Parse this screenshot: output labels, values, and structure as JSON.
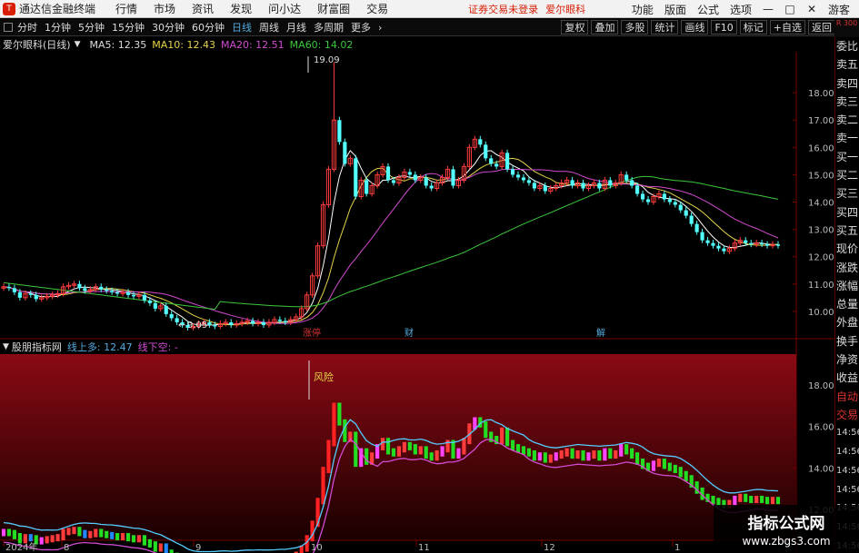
{
  "menubar": {
    "app_title": "通达信金融终端",
    "menus": [
      "行情",
      "市场",
      "资讯",
      "发现",
      "问小达",
      "财富圈",
      "交易"
    ],
    "notice": "证券交易未登录",
    "stock_notice": "爱尔眼科",
    "right_menus": [
      "功能",
      "版面",
      "公式",
      "选项"
    ],
    "guest": "游客"
  },
  "toolbar": {
    "periods": [
      "分时",
      "1分钟",
      "5分钟",
      "15分钟",
      "30分钟",
      "60分钟",
      "日线",
      "周线",
      "月线",
      "多周期",
      "更多"
    ],
    "active_period": "日线",
    "right_buttons": [
      "复权",
      "叠加",
      "多股",
      "统计",
      "画线",
      "F10",
      "标记",
      "+自选",
      "返回"
    ]
  },
  "main": {
    "stock_name": "爱尔眼科(日线)",
    "ma5": "MA5: 12.35",
    "ma10": "MA10: 12.43",
    "ma20": "MA20: 12.51",
    "ma60": "MA60: 14.02",
    "high_label": "19.09",
    "low_label": "9.05",
    "events": [
      "涨停",
      "财",
      "解"
    ]
  },
  "indicator": {
    "name": "股朋指标网",
    "up_label": "线上多: 12.47",
    "down_label": "线下空: -",
    "risk_label": "风险"
  },
  "time_axis": [
    "2024年",
    "8",
    "9",
    "10",
    "11",
    "12",
    "1"
  ],
  "side_header": "R 300",
  "side_panel": [
    "委比",
    "卖五",
    "卖四",
    "卖三",
    "卖二",
    "卖一",
    "买一",
    "买二",
    "买三",
    "买四",
    "买五",
    "现价",
    "涨跌",
    "涨幅",
    "总量",
    "外盘",
    "换手",
    "净资",
    "收益",
    "自动",
    "交易",
    "14:56",
    "14:56",
    "14:56",
    "14:56",
    "14:56",
    "14:56",
    "14:56",
    "14:56"
  ],
  "watermark": {
    "line1": "指标公式网",
    "line2": "www.zbgs3.com"
  },
  "chart_data": {
    "type": "candlestick",
    "main_axis_ticks": [
      18.0,
      17.0,
      16.0,
      15.0,
      14.0,
      13.0,
      12.0,
      11.0,
      10.0
    ],
    "main_ylim": [
      9.0,
      19.5
    ],
    "sub_axis_ticks": [
      18.0,
      16.0,
      14.0,
      12.0
    ],
    "sub_ylim": [
      10.5,
      19.5
    ],
    "closes": [
      10.9,
      10.85,
      10.7,
      10.5,
      10.65,
      10.6,
      10.45,
      10.5,
      10.55,
      10.6,
      10.65,
      10.9,
      10.95,
      11.0,
      10.85,
      10.75,
      10.8,
      10.9,
      10.8,
      10.75,
      10.7,
      10.65,
      10.7,
      10.6,
      10.55,
      10.6,
      10.4,
      10.3,
      10.1,
      10.2,
      9.9,
      9.75,
      9.6,
      9.5,
      9.4,
      9.45,
      9.55,
      9.6,
      9.5,
      9.45,
      9.55,
      9.6,
      9.5,
      9.55,
      9.6,
      9.65,
      9.55,
      9.6,
      9.5,
      9.6,
      9.7,
      9.65,
      9.6,
      9.7,
      9.8,
      10.1,
      10.6,
      11.3,
      12.4,
      13.9,
      15.2,
      17.0,
      16.2,
      15.4,
      15.6,
      14.2,
      14.8,
      14.3,
      14.6,
      15.0,
      15.3,
      14.8,
      14.7,
      14.9,
      15.1,
      15.0,
      14.8,
      14.9,
      14.6,
      14.5,
      14.7,
      14.9,
      15.2,
      14.6,
      14.8,
      15.3,
      16.0,
      16.3,
      16.1,
      15.6,
      15.4,
      15.3,
      15.8,
      15.2,
      15.0,
      14.9,
      14.8,
      14.7,
      14.5,
      14.6,
      14.4,
      14.5,
      14.6,
      14.7,
      14.8,
      14.6,
      14.7,
      14.5,
      14.6,
      14.7,
      14.5,
      14.8,
      14.6,
      14.7,
      15.0,
      14.8,
      14.6,
      14.3,
      14.1,
      14.0,
      14.2,
      14.3,
      14.1,
      14.0,
      13.9,
      13.7,
      13.5,
      13.2,
      12.9,
      12.6,
      12.5,
      12.4,
      12.3,
      12.2,
      12.3,
      12.5,
      12.6,
      12.5,
      12.45,
      12.5,
      12.45,
      12.4,
      12.45,
      12.4
    ]
  }
}
